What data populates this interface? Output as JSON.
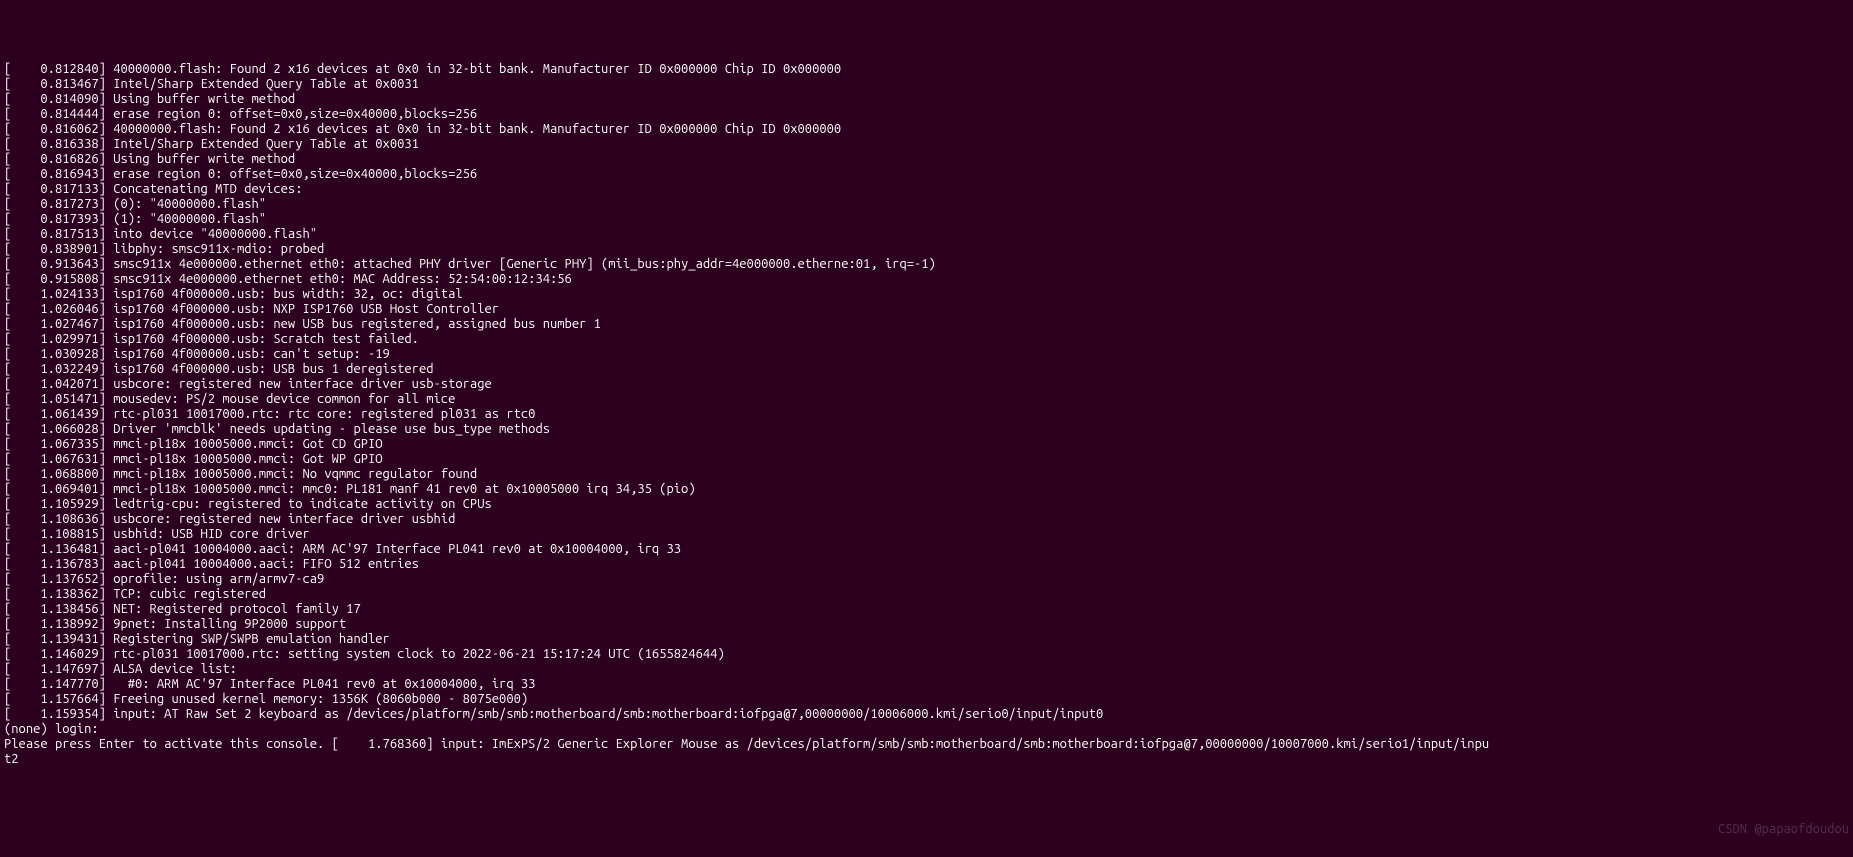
{
  "log_lines": [
    "[    0.812840] 40000000.flash: Found 2 x16 devices at 0x0 in 32-bit bank. Manufacturer ID 0x000000 Chip ID 0x000000",
    "[    0.813467] Intel/Sharp Extended Query Table at 0x0031",
    "[    0.814090] Using buffer write method",
    "[    0.814444] erase region 0: offset=0x0,size=0x40000,blocks=256",
    "[    0.816062] 40000000.flash: Found 2 x16 devices at 0x0 in 32-bit bank. Manufacturer ID 0x000000 Chip ID 0x000000",
    "[    0.816338] Intel/Sharp Extended Query Table at 0x0031",
    "[    0.816826] Using buffer write method",
    "[    0.816943] erase region 0: offset=0x0,size=0x40000,blocks=256",
    "[    0.817133] Concatenating MTD devices:",
    "[    0.817273] (0): \"40000000.flash\"",
    "[    0.817393] (1): \"40000000.flash\"",
    "[    0.817513] into device \"40000000.flash\"",
    "[    0.838901] libphy: smsc911x-mdio: probed",
    "[    0.913643] smsc911x 4e000000.ethernet eth0: attached PHY driver [Generic PHY] (mii_bus:phy_addr=4e000000.etherne:01, irq=-1)",
    "[    0.915808] smsc911x 4e000000.ethernet eth0: MAC Address: 52:54:00:12:34:56",
    "[    1.024133] isp1760 4f000000.usb: bus width: 32, oc: digital",
    "[    1.026046] isp1760 4f000000.usb: NXP ISP1760 USB Host Controller",
    "[    1.027467] isp1760 4f000000.usb: new USB bus registered, assigned bus number 1",
    "[    1.029971] isp1760 4f000000.usb: Scratch test failed.",
    "[    1.030928] isp1760 4f000000.usb: can't setup: -19",
    "[    1.032249] isp1760 4f000000.usb: USB bus 1 deregistered",
    "[    1.042071] usbcore: registered new interface driver usb-storage",
    "[    1.051471] mousedev: PS/2 mouse device common for all mice",
    "[    1.061439] rtc-pl031 10017000.rtc: rtc core: registered pl031 as rtc0",
    "[    1.066028] Driver 'mmcblk' needs updating - please use bus_type methods",
    "[    1.067335] mmci-pl18x 10005000.mmci: Got CD GPIO",
    "[    1.067631] mmci-pl18x 10005000.mmci: Got WP GPIO",
    "[    1.068800] mmci-pl18x 10005000.mmci: No vqmmc regulator found",
    "[    1.069401] mmci-pl18x 10005000.mmci: mmc0: PL181 manf 41 rev0 at 0x10005000 irq 34,35 (pio)",
    "[    1.105929] ledtrig-cpu: registered to indicate activity on CPUs",
    "[    1.108636] usbcore: registered new interface driver usbhid",
    "[    1.108815] usbhid: USB HID core driver",
    "[    1.136481] aaci-pl041 10004000.aaci: ARM AC'97 Interface PL041 rev0 at 0x10004000, irq 33",
    "[    1.136783] aaci-pl041 10004000.aaci: FIFO 512 entries",
    "[    1.137652] oprofile: using arm/armv7-ca9",
    "[    1.138362] TCP: cubic registered",
    "[    1.138456] NET: Registered protocol family 17",
    "[    1.138992] 9pnet: Installing 9P2000 support",
    "[    1.139431] Registering SWP/SWPB emulation handler",
    "[    1.146029] rtc-pl031 10017000.rtc: setting system clock to 2022-06-21 15:17:24 UTC (1655824644)",
    "[    1.147697] ALSA device list:",
    "[    1.147770]   #0: ARM AC'97 Interface PL041 rev0 at 0x10004000, irq 33",
    "[    1.157664] Freeing unused kernel memory: 1356K (8060b000 - 8075e000)",
    "[    1.159354] input: AT Raw Set 2 keyboard as /devices/platform/smb/smb:motherboard/smb:motherboard:iofpga@7,00000000/10006000.kmi/serio0/input/input0",
    "(none) login: ",
    "Please press Enter to activate this console. [    1.768360] input: ImExPS/2 Generic Explorer Mouse as /devices/platform/smb/smb:motherboard/smb:motherboard:iofpga@7,00000000/10007000.kmi/serio1/input/inpu",
    "t2"
  ],
  "watermark": "CSDN @papaofdoudou"
}
